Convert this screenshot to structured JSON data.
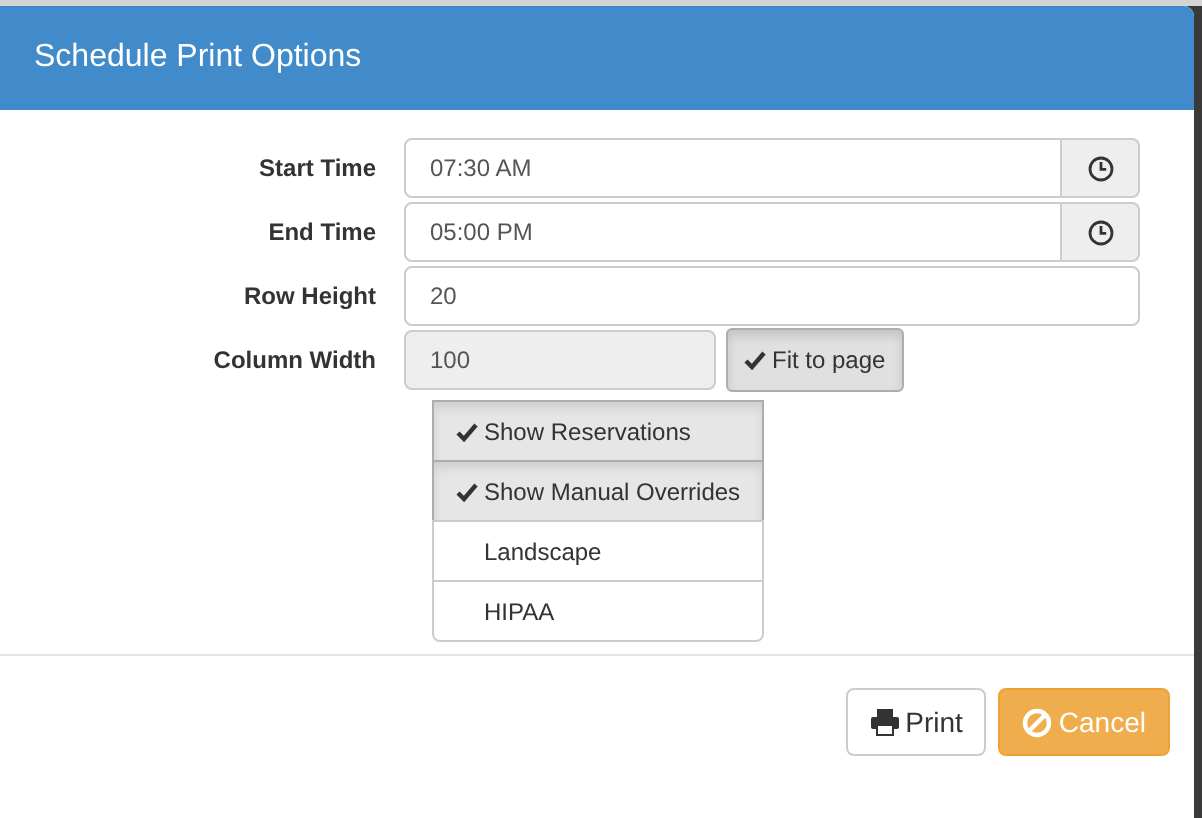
{
  "dialog": {
    "title": "Schedule Print Options"
  },
  "fields": [
    {
      "kind": "time",
      "label": "Start Time",
      "value": "07:30 AM"
    },
    {
      "kind": "time",
      "label": "End Time",
      "value": "05:00 PM"
    },
    {
      "kind": "text",
      "label": "Row Height",
      "value": "20"
    },
    {
      "kind": "toggle",
      "label": "Column Width",
      "value": "100",
      "disabled": true,
      "toggle": {
        "label": "Fit to page",
        "checked": true
      }
    }
  ],
  "options": [
    {
      "label": "Show Reservations",
      "checked": true
    },
    {
      "label": "Show Manual Overrides",
      "checked": true
    },
    {
      "label": "Landscape",
      "checked": false
    },
    {
      "label": "HIPAA",
      "checked": false
    }
  ],
  "buttons": [
    {
      "kind": "default",
      "label": "Print"
    },
    {
      "kind": "warning",
      "label": "Cancel"
    }
  ]
}
